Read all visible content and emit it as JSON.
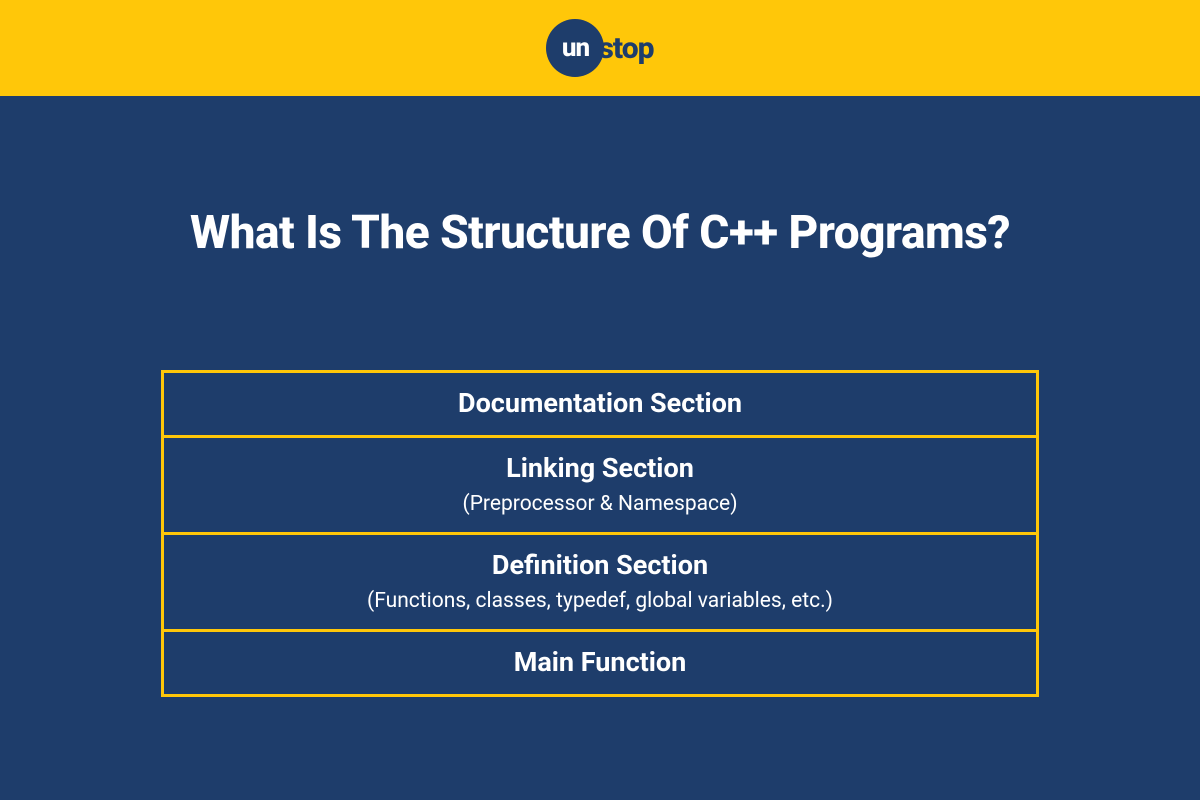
{
  "brand": {
    "circle_text": "un",
    "tail_text": "stop"
  },
  "page": {
    "title": "What Is The Structure Of C++ Programs?"
  },
  "sections": [
    {
      "title": "Documentation Section",
      "sub": ""
    },
    {
      "title": "Linking Section",
      "sub": "(Preprocessor & Namespace)"
    },
    {
      "title": "Definition Section",
      "sub": "(Functions, classes, typedef, global variables, etc.)"
    },
    {
      "title": "Main Function",
      "sub": ""
    }
  ]
}
